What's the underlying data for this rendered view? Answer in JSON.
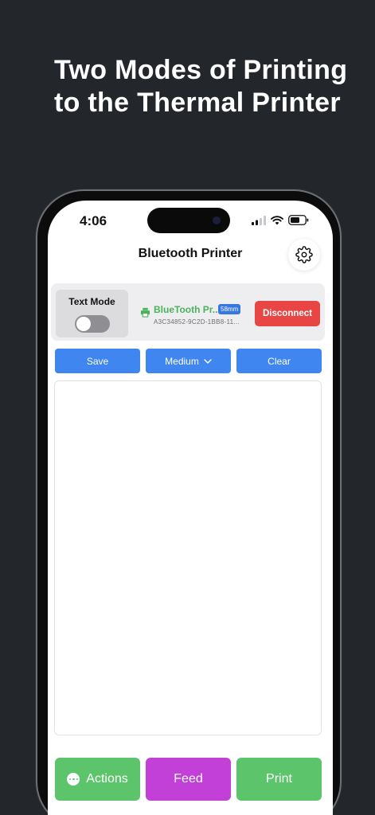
{
  "headline": {
    "line1": "Two Modes of Printing",
    "line2": "to the Thermal Printer"
  },
  "status_bar": {
    "time": "4:06"
  },
  "app": {
    "title": "Bluetooth Printer",
    "mode": {
      "label": "Text Mode",
      "enabled": false
    },
    "printer": {
      "name": "BlueTooth Pr...",
      "paper_size": "58mm",
      "id": "A3C34852-9C2D-1BB8-11...",
      "disconnect_label": "Disconnect"
    },
    "toolbar": {
      "save_label": "Save",
      "size_label": "Medium",
      "clear_label": "Clear"
    },
    "editor": {
      "value": ""
    },
    "bottom": {
      "actions_label": "Actions",
      "feed_label": "Feed",
      "print_label": "Print"
    }
  },
  "colors": {
    "background": "#23272c",
    "primary_blue": "#3f86f1",
    "disconnect_red": "#e84545",
    "actions_green": "#5cc46b",
    "feed_purple": "#c23fd8",
    "print_green": "#5cc46b",
    "printer_green": "#49b35c"
  }
}
